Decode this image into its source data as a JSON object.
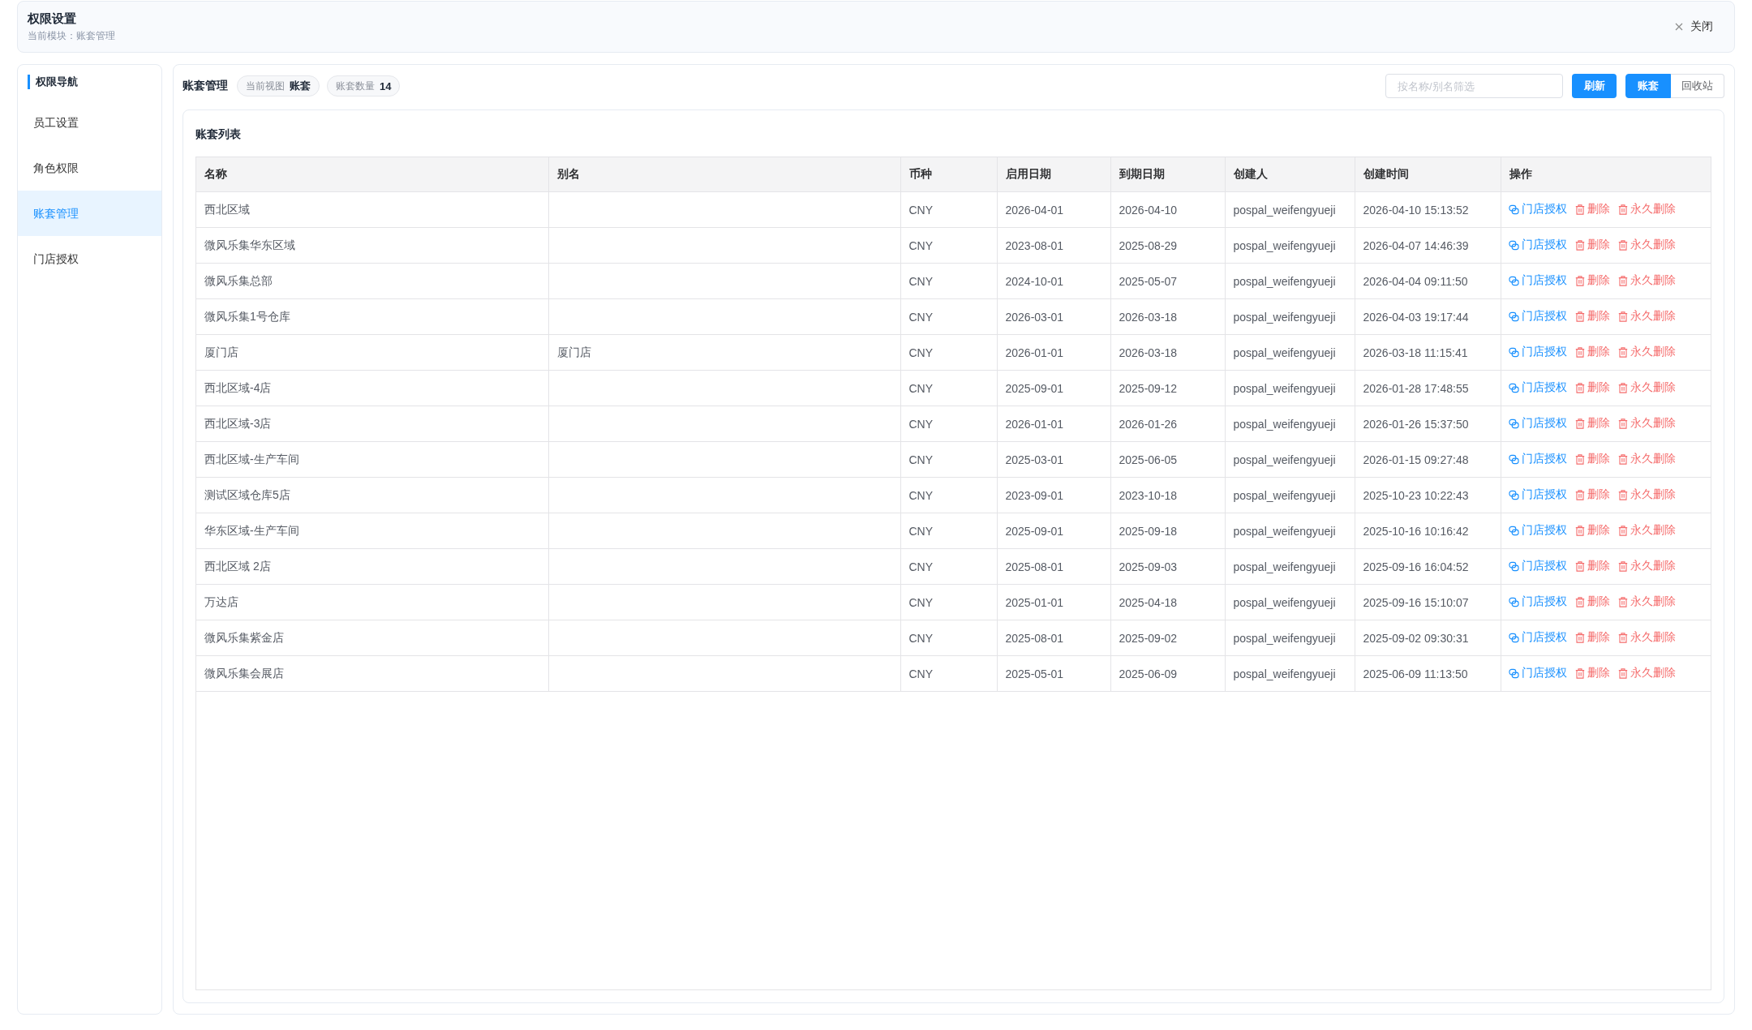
{
  "header": {
    "title": "权限设置",
    "subtitle": "当前模块：账套管理",
    "close": "关闭"
  },
  "sidebar": {
    "title": "权限导航",
    "items": [
      {
        "label": "员工设置",
        "selected": false
      },
      {
        "label": "角色权限",
        "selected": false
      },
      {
        "label": "账套管理",
        "selected": true
      },
      {
        "label": "门店授权",
        "selected": false
      }
    ]
  },
  "toolbar": {
    "title": "账套管理",
    "chips": [
      {
        "label": "当前视图",
        "value": "账套"
      },
      {
        "label": "账套数量",
        "value": "14"
      }
    ],
    "search": {
      "placeholder": "按名称/别名筛选"
    },
    "refresh": "刷新",
    "views": [
      {
        "label": "账套",
        "selected": true
      },
      {
        "label": "回收站",
        "selected": false
      }
    ]
  },
  "table": {
    "title": "账套列表",
    "columns": [
      "名称",
      "别名",
      "币种",
      "启用日期",
      "到期日期",
      "创建人",
      "创建时间",
      "操作"
    ],
    "rows": [
      {
        "name": "西北区域",
        "currency": "CNY",
        "start_date": "2026-04-01",
        "end_date": "2026-04-10",
        "creator": "pospal_weifengyueji",
        "created_at": "2026-04-10 15:13:52",
        "actions": [
          {
            "kind": "grant",
            "label": "门店授权"
          },
          {
            "kind": "delete",
            "label": "删除"
          },
          {
            "kind": "purge",
            "label": "永久删除"
          }
        ]
      },
      {
        "name": "微风乐集华东区域",
        "currency": "CNY",
        "start_date": "2023-08-01",
        "end_date": "2025-08-29",
        "creator": "pospal_weifengyueji",
        "created_at": "2026-04-07 14:46:39",
        "actions": [
          {
            "kind": "grant",
            "label": "门店授权"
          },
          {
            "kind": "delete",
            "label": "删除"
          },
          {
            "kind": "purge",
            "label": "永久删除"
          }
        ]
      },
      {
        "name": "微风乐集总部",
        "currency": "CNY",
        "start_date": "2024-10-01",
        "end_date": "2025-05-07",
        "creator": "pospal_weifengyueji",
        "created_at": "2026-04-04 09:11:50",
        "actions": [
          {
            "kind": "grant",
            "label": "门店授权"
          },
          {
            "kind": "delete",
            "label": "删除"
          },
          {
            "kind": "purge",
            "label": "永久删除"
          }
        ]
      },
      {
        "name": "微风乐集1号仓库",
        "currency": "CNY",
        "start_date": "2026-03-01",
        "end_date": "2026-03-18",
        "creator": "pospal_weifengyueji",
        "created_at": "2026-04-03 19:17:44",
        "actions": [
          {
            "kind": "grant",
            "label": "门店授权"
          },
          {
            "kind": "delete",
            "label": "删除"
          },
          {
            "kind": "purge",
            "label": "永久删除"
          }
        ]
      },
      {
        "name": "厦门店",
        "alias": "厦门店",
        "currency": "CNY",
        "start_date": "2026-01-01",
        "end_date": "2026-03-18",
        "creator": "pospal_weifengyueji",
        "created_at": "2026-03-18 11:15:41",
        "actions": [
          {
            "kind": "grant",
            "label": "门店授权"
          },
          {
            "kind": "delete",
            "label": "删除"
          },
          {
            "kind": "purge",
            "label": "永久删除"
          }
        ]
      },
      {
        "name": "西北区域-4店",
        "currency": "CNY",
        "start_date": "2025-09-01",
        "end_date": "2025-09-12",
        "creator": "pospal_weifengyueji",
        "created_at": "2026-01-28 17:48:55",
        "actions": [
          {
            "kind": "grant",
            "label": "门店授权"
          },
          {
            "kind": "delete",
            "label": "删除"
          },
          {
            "kind": "purge",
            "label": "永久删除"
          }
        ]
      },
      {
        "name": "西北区域-3店",
        "currency": "CNY",
        "start_date": "2026-01-01",
        "end_date": "2026-01-26",
        "creator": "pospal_weifengyueji",
        "created_at": "2026-01-26 15:37:50",
        "actions": [
          {
            "kind": "grant",
            "label": "门店授权"
          },
          {
            "kind": "delete",
            "label": "删除"
          },
          {
            "kind": "purge",
            "label": "永久删除"
          }
        ]
      },
      {
        "name": "西北区域-生产车间",
        "currency": "CNY",
        "start_date": "2025-03-01",
        "end_date": "2025-06-05",
        "creator": "pospal_weifengyueji",
        "created_at": "2026-01-15 09:27:48",
        "actions": [
          {
            "kind": "grant",
            "label": "门店授权"
          },
          {
            "kind": "delete",
            "label": "删除"
          },
          {
            "kind": "purge",
            "label": "永久删除"
          }
        ]
      },
      {
        "name": "测试区域仓库5店",
        "currency": "CNY",
        "start_date": "2023-09-01",
        "end_date": "2023-10-18",
        "creator": "pospal_weifengyueji",
        "created_at": "2025-10-23 10:22:43",
        "actions": [
          {
            "kind": "grant",
            "label": "门店授权"
          },
          {
            "kind": "delete",
            "label": "删除"
          },
          {
            "kind": "purge",
            "label": "永久删除"
          }
        ]
      },
      {
        "name": "华东区域-生产车间",
        "currency": "CNY",
        "start_date": "2025-09-01",
        "end_date": "2025-09-18",
        "creator": "pospal_weifengyueji",
        "created_at": "2025-10-16 10:16:42",
        "actions": [
          {
            "kind": "grant",
            "label": "门店授权"
          },
          {
            "kind": "delete",
            "label": "删除"
          },
          {
            "kind": "purge",
            "label": "永久删除"
          }
        ]
      },
      {
        "name": "西北区域 2店",
        "currency": "CNY",
        "start_date": "2025-08-01",
        "end_date": "2025-09-03",
        "creator": "pospal_weifengyueji",
        "created_at": "2025-09-16 16:04:52",
        "actions": [
          {
            "kind": "grant",
            "label": "门店授权"
          },
          {
            "kind": "delete",
            "label": "删除"
          },
          {
            "kind": "purge",
            "label": "永久删除"
          }
        ]
      },
      {
        "name": "万达店",
        "currency": "CNY",
        "start_date": "2025-01-01",
        "end_date": "2025-04-18",
        "creator": "pospal_weifengyueji",
        "created_at": "2025-09-16 15:10:07",
        "actions": [
          {
            "kind": "grant",
            "label": "门店授权"
          },
          {
            "kind": "delete",
            "label": "删除"
          },
          {
            "kind": "purge",
            "label": "永久删除"
          }
        ]
      },
      {
        "name": "微风乐集紫金店",
        "currency": "CNY",
        "start_date": "2025-08-01",
        "end_date": "2025-09-02",
        "creator": "pospal_weifengyueji",
        "created_at": "2025-09-02 09:30:31",
        "actions": [
          {
            "kind": "grant",
            "label": "门店授权"
          },
          {
            "kind": "delete",
            "label": "删除"
          },
          {
            "kind": "purge",
            "label": "永久删除"
          }
        ]
      },
      {
        "name": "微风乐集会展店",
        "currency": "CNY",
        "start_date": "2025-05-01",
        "end_date": "2025-06-09",
        "creator": "pospal_weifengyueji",
        "created_at": "2025-06-09 11:13:50",
        "actions": [
          {
            "kind": "grant",
            "label": "门店授权"
          },
          {
            "kind": "delete",
            "label": "删除"
          },
          {
            "kind": "purge",
            "label": "永久删除"
          }
        ]
      }
    ]
  }
}
